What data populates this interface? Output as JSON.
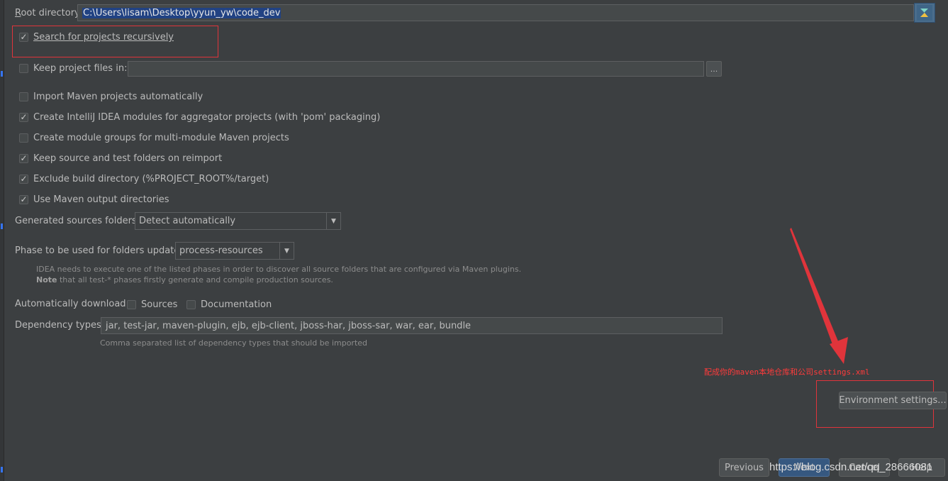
{
  "root_directory": {
    "label": "Root directory",
    "value": "C:\\Users\\lisam\\Desktop\\yyun_yw\\code_dev"
  },
  "options": {
    "search_recursive": {
      "label": "Search for projects recursively",
      "checked": true
    },
    "keep_project_files": {
      "label": "Keep project files in:",
      "checked": false,
      "value": "",
      "browse_label": "..."
    },
    "import_auto": {
      "label": "Import Maven projects automatically",
      "checked": false
    },
    "create_modules": {
      "label": "Create IntelliJ IDEA modules for aggregator projects (with 'pom' packaging)",
      "checked": true
    },
    "module_groups": {
      "label": "Create module groups for multi-module Maven projects",
      "checked": false
    },
    "keep_source": {
      "label": "Keep source and test folders on reimport",
      "checked": true
    },
    "exclude_build": {
      "label": "Exclude build directory (%PROJECT_ROOT%/target)",
      "checked": true
    },
    "use_output": {
      "label": "Use Maven output directories",
      "checked": true
    }
  },
  "generated_sources": {
    "label": "Generated sources folders:",
    "value": "Detect automatically"
  },
  "phase": {
    "label": "Phase to be used for folders update:",
    "value": "process-resources",
    "hint_line1": "IDEA needs to execute one of the listed phases in order to discover all source folders that are configured via Maven plugins.",
    "hint_note_bold": "Note",
    "hint_line2_rest": " that all test-* phases firstly generate and compile production sources."
  },
  "auto_download": {
    "label": "Automatically download:",
    "sources": {
      "label": "Sources",
      "checked": false
    },
    "documentation": {
      "label": "Documentation",
      "checked": false
    }
  },
  "dependency_types": {
    "label": "Dependency types:",
    "value": "jar, test-jar, maven-plugin, ejb, ejb-client, jboss-har, jboss-sar, war, ear, bundle",
    "hint": "Comma separated list of dependency types that should be imported"
  },
  "annotation": "配成你的maven本地仓库和公司settings.xml",
  "buttons": {
    "environment_settings": "Environment settings...",
    "previous": "Previous",
    "next": "Next",
    "cancel": "Cancel",
    "help": "Help"
  },
  "watermark": "https://blog.csdn.net/qq_28666081",
  "colors": {
    "background": "#3c3f41",
    "accent": "#214283",
    "annotation_red": "#e0343b"
  }
}
